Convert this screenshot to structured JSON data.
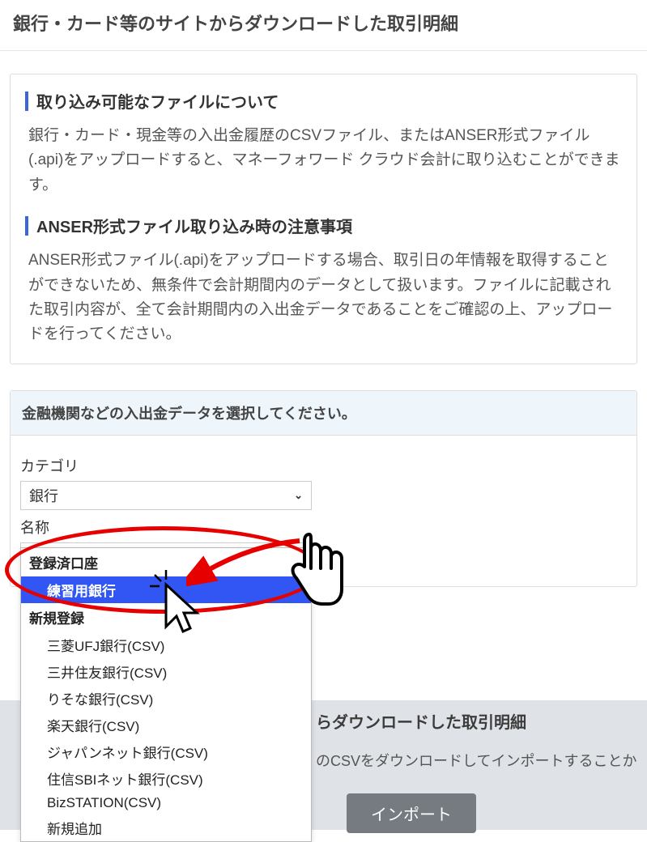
{
  "page_title": "銀行・カード等のサイトからダウンロードした取引明細",
  "info": {
    "heading1": "取り込み可能なファイルについて",
    "text1": "銀行・カード・現金等の入出金履歴のCSVファイル、またはANSER形式ファイル(.api)をアップロードすると、マネーフォワード クラウド会計に取り込むことができます。",
    "heading2": "ANSER形式ファイル取り込み時の注意事項",
    "text2": "ANSER形式ファイル(.api)をアップロードする場合、取引日の年情報を取得することができないため、無条件で会計期間内のデータとして扱います。ファイルに記載された取引内容が、全て会計期間内の入出金データであることをご確認の上、アップロードを行ってください。"
  },
  "select_panel": {
    "header": "金融機関などの入出金データを選択してください。",
    "category_label": "カテゴリ",
    "category_value": "銀行",
    "name_label": "名称",
    "name_value": "練習用銀行"
  },
  "dropdown": {
    "group1": "登録済口座",
    "group1_items": [
      "練習用銀行"
    ],
    "group2": "新規登録",
    "group2_items": [
      "三菱UFJ銀行(CSV)",
      "三井住友銀行(CSV)",
      "りそな銀行(CSV)",
      "楽天銀行(CSV)",
      "ジャパンネット銀行(CSV)",
      "住信SBIネット銀行(CSV)",
      "BizSTATION(CSV)",
      "新規追加"
    ]
  },
  "bg": {
    "title": "らダウンロードした取引明細",
    "sub": "のCSVをダウンロードしてインポートすることか",
    "import_label": "インポート"
  }
}
